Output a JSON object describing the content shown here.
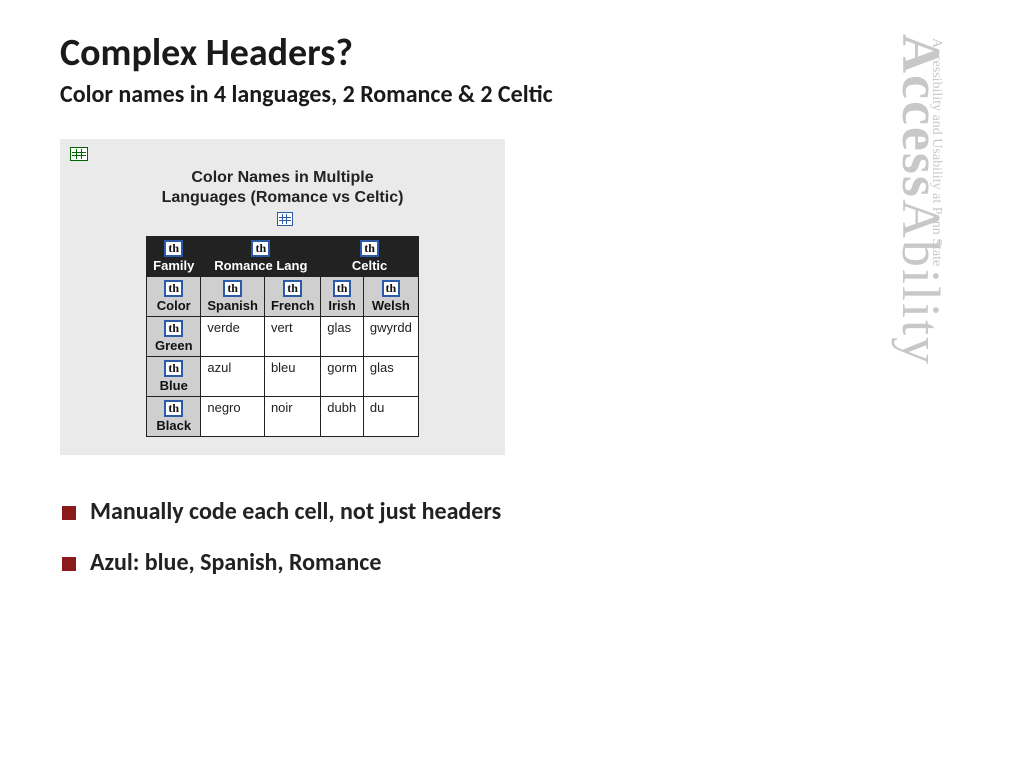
{
  "title": "Complex Headers?",
  "subtitle": "Color names in 4 languages, 2 Romance & 2 Celtic",
  "panel": {
    "caption_line1": "Color Names in Multiple",
    "caption_line2": "Languages (Romance vs Celtic)"
  },
  "th_badge": "th",
  "groups": {
    "family": "Family",
    "romance": "Romance Lang",
    "celtic": "Celtic"
  },
  "cols": {
    "color": "Color",
    "spanish": "Spanish",
    "french": "French",
    "irish": "Irish",
    "welsh": "Welsh"
  },
  "rows": [
    {
      "name": "Green",
      "spanish": "verde",
      "french": "vert",
      "irish": "glas",
      "welsh": "gwyrdd"
    },
    {
      "name": "Blue",
      "spanish": "azul",
      "french": "bleu",
      "irish": "gorm",
      "welsh": "glas"
    },
    {
      "name": "Black",
      "spanish": "negro",
      "french": "noir",
      "irish": "dubh",
      "welsh": "du"
    }
  ],
  "bullets": [
    "Manually code each cell, not just headers",
    "Azul:  blue, Spanish, Romance"
  ],
  "brand": {
    "bold": "Access",
    "light": "Ability",
    "tagline": "Accessibility and Usability at Penn State"
  }
}
